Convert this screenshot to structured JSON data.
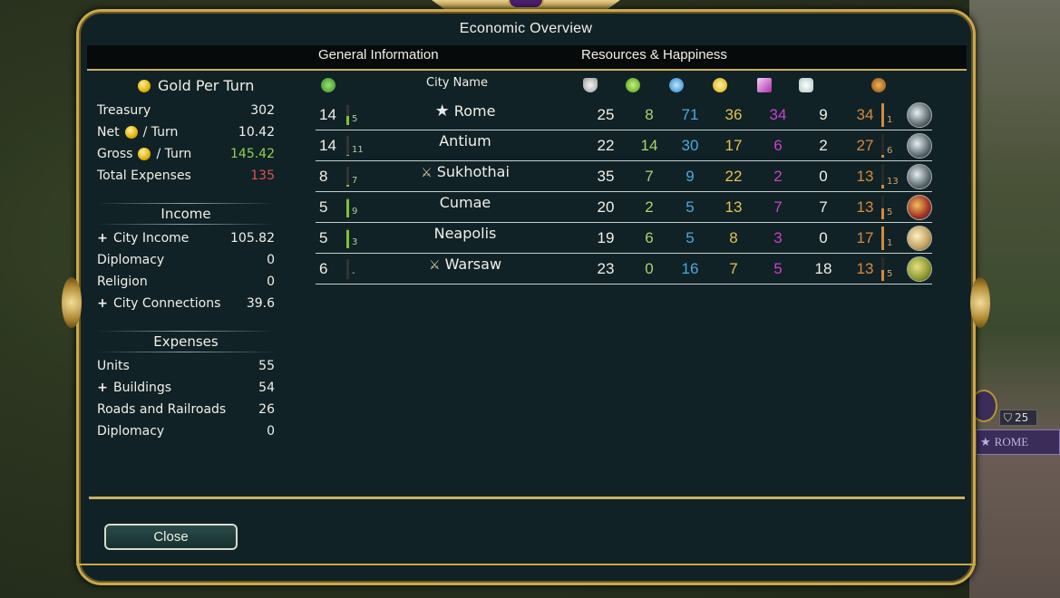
{
  "window": {
    "title": "Economic Overview"
  },
  "tabs": {
    "general": "General Information",
    "resources": "Resources & Happiness"
  },
  "gold": {
    "title": "Gold Per Turn",
    "treasury_label": "Treasury",
    "treasury": "302",
    "net_label": "Net",
    "net_suffix": "/ Turn",
    "net": "10.42",
    "gross_label": "Gross",
    "gross_suffix": "/ Turn",
    "gross": "145.42",
    "expenses_label": "Total Expenses",
    "expenses": "135"
  },
  "income": {
    "title": "Income",
    "rows": [
      {
        "label": "City Income",
        "value": "105.82",
        "expandable": true
      },
      {
        "label": "Diplomacy",
        "value": "0",
        "expandable": false
      },
      {
        "label": "Religion",
        "value": "0",
        "expandable": false
      },
      {
        "label": "City Connections",
        "value": "39.6",
        "expandable": true
      }
    ]
  },
  "expenses": {
    "title": "Expenses",
    "rows": [
      {
        "label": "Units",
        "value": "55",
        "expandable": false
      },
      {
        "label": "Buildings",
        "value": "54",
        "expandable": true
      },
      {
        "label": "Roads and Railroads",
        "value": "26",
        "expandable": false
      },
      {
        "label": "Diplomacy",
        "value": "0",
        "expandable": false
      }
    ]
  },
  "table": {
    "city_name_header": "City Name",
    "header_icons": [
      "growth-icon",
      "defense-icon",
      "food-icon",
      "science-icon",
      "gold-icon",
      "culture-icon",
      "faith-icon",
      "production-icon"
    ],
    "rows": [
      {
        "pop": "14",
        "growth": "5",
        "growth_fill": 0.45,
        "name": "Rome",
        "marker": "capital-star",
        "defense": "25",
        "food": "8",
        "science": "71",
        "gold": "36",
        "culture": "34",
        "faith": "9",
        "production": "34",
        "prod_turns": "1",
        "prod_fill": 1.0,
        "building": "moon"
      },
      {
        "pop": "14",
        "growth": "11",
        "growth_fill": 0.05,
        "name": "Antium",
        "marker": "",
        "defense": "22",
        "food": "14",
        "science": "30",
        "gold": "17",
        "culture": "6",
        "faith": "2",
        "production": "27",
        "prod_turns": "6",
        "prod_fill": 0.1,
        "building": "moon"
      },
      {
        "pop": "8",
        "growth": "7",
        "growth_fill": 0.1,
        "name": "Sukhothai",
        "marker": "puppet",
        "defense": "35",
        "food": "7",
        "science": "9",
        "gold": "22",
        "culture": "2",
        "faith": "0",
        "production": "13",
        "prod_turns": "13",
        "prod_fill": 0.15,
        "building": "moon"
      },
      {
        "pop": "5",
        "growth": "9",
        "growth_fill": 0.9,
        "name": "Cumae",
        "marker": "",
        "defense": "20",
        "food": "2",
        "science": "5",
        "gold": "13",
        "culture": "7",
        "faith": "7",
        "production": "13",
        "prod_turns": "5",
        "prod_fill": 0.45,
        "building": "ship"
      },
      {
        "pop": "5",
        "growth": "3",
        "growth_fill": 0.9,
        "name": "Neapolis",
        "marker": "",
        "defense": "19",
        "food": "6",
        "science": "5",
        "gold": "8",
        "culture": "3",
        "faith": "0",
        "production": "17",
        "prod_turns": "1",
        "prod_fill": 1.0,
        "building": "scroll"
      },
      {
        "pop": "6",
        "growth": "-",
        "growth_fill": 0.0,
        "name": "Warsaw",
        "marker": "puppet",
        "defense": "23",
        "food": "0",
        "science": "16",
        "gold": "7",
        "culture": "5",
        "faith": "18",
        "production": "13",
        "prod_turns": "5",
        "prod_fill": 0.45,
        "building": "food"
      }
    ]
  },
  "colors": {
    "food": "#a9d46a",
    "science": "#4aa8e0",
    "gold": "#e8c04a",
    "culture": "#cc3fcc",
    "faith": "#f2efe6",
    "production": "#d98a3a",
    "gross": "#8fd14f",
    "expenses": "#e05050"
  },
  "buttons": {
    "close": "Close"
  },
  "map": {
    "city_label": "ROME",
    "defense": "25"
  }
}
